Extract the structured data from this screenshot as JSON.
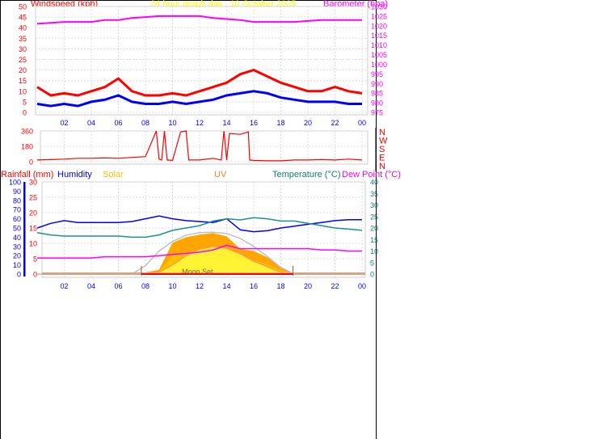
{
  "title": "24 hour graph day : 10 October 2025",
  "hour_labels": [
    "02",
    "04",
    "06",
    "08",
    "10",
    "12",
    "14",
    "16",
    "18",
    "20",
    "22",
    "00"
  ],
  "chart_data": [
    {
      "type": "line",
      "name": "wind-barometer",
      "left_label": "Windspeed (kph)",
      "right_label": "Barometer (hpa)",
      "ylim": [
        0,
        50
      ],
      "y_ticks": [
        "0",
        "5",
        "10",
        "15",
        "20",
        "25",
        "30",
        "35",
        "40",
        "45",
        "50"
      ],
      "y2lim": [
        975,
        1030
      ],
      "y2_ticks": [
        "975",
        "980",
        "985",
        "990",
        "995",
        "1000",
        "1005",
        "1010",
        "1015",
        "1020",
        "1025",
        "1030"
      ],
      "x_hours": [
        0,
        1,
        2,
        3,
        4,
        5,
        6,
        7,
        8,
        9,
        10,
        11,
        12,
        13,
        14,
        15,
        16,
        17,
        18,
        19,
        20,
        21,
        22,
        23,
        24
      ],
      "grid": true,
      "series": [
        {
          "key": "gust",
          "color": "#ff0000",
          "values": [
            12,
            8,
            9,
            8,
            10,
            12,
            16,
            10,
            8,
            8,
            9,
            8,
            10,
            12,
            14,
            18,
            20,
            17,
            14,
            12,
            10,
            10,
            12,
            10,
            9
          ]
        },
        {
          "key": "speed",
          "color": "#0000ff",
          "values": [
            4,
            3,
            4,
            3,
            5,
            6,
            8,
            5,
            4,
            4,
            5,
            4,
            5,
            6,
            8,
            9,
            10,
            9,
            7,
            6,
            5,
            5,
            5,
            4,
            4
          ]
        },
        {
          "key": "barometer",
          "color": "#ff00ff",
          "axis": "right",
          "values": [
            1021,
            1021.5,
            1022,
            1022,
            1022,
            1023,
            1023,
            1024,
            1024.5,
            1025,
            1025,
            1025,
            1025,
            1024,
            1023.5,
            1023,
            1022,
            1022,
            1022,
            1022,
            1022.5,
            1023,
            1023,
            1023,
            1023
          ]
        }
      ]
    },
    {
      "type": "line",
      "name": "wind-direction",
      "ylim": [
        0,
        360
      ],
      "y_ticks": [
        "0",
        "180",
        "360"
      ],
      "compass_labels": [
        "N",
        "W",
        "S",
        "E",
        "N"
      ],
      "x_hours": [
        0,
        1,
        2,
        3,
        4,
        5,
        6,
        7,
        8,
        8.8,
        9,
        9.2,
        9.4,
        9.6,
        10,
        10.6,
        11,
        11.2,
        12,
        13,
        13.6,
        13.8,
        14,
        14.2,
        15,
        15.6,
        15.7,
        16,
        17,
        18,
        19,
        20,
        21,
        22,
        23,
        24
      ],
      "series": [
        {
          "key": "direction",
          "color": "#ff0000",
          "values": [
            20,
            25,
            30,
            40,
            40,
            45,
            40,
            50,
            60,
            360,
            30,
            20,
            360,
            20,
            15,
            350,
            360,
            20,
            20,
            40,
            20,
            360,
            20,
            330,
            320,
            350,
            20,
            15,
            10,
            10,
            20,
            20,
            25,
            20,
            30,
            20
          ]
        }
      ]
    },
    {
      "type": "line",
      "name": "rain-humidity-solar-temp",
      "labels": {
        "rainfall": "Rainfall (mm)",
        "humidity": "Humidity",
        "solar": "Solar",
        "uv": "UV",
        "temperature": "Temperature (°C)",
        "dewpoint": "Dew Point (°C)"
      },
      "humidity_ticks": [
        "0",
        "10",
        "20",
        "30",
        "40",
        "50",
        "60",
        "70",
        "80",
        "90",
        "100"
      ],
      "rain_ticks": [
        "0",
        "5",
        "10",
        "15",
        "20",
        "25",
        "30"
      ],
      "temp_ticks": [
        "0",
        "5",
        "10",
        "15",
        "20",
        "25",
        "30",
        "35",
        "40"
      ],
      "humidity_lim": [
        0,
        100
      ],
      "rain_lim": [
        0,
        30
      ],
      "temp_lim": [
        0,
        40
      ],
      "annotation": "Moon Set",
      "sunrise_hour": 7.7,
      "sunset_hour": 18.9,
      "x_hours": [
        0,
        1,
        2,
        3,
        4,
        5,
        6,
        7,
        8,
        9,
        10,
        11,
        12,
        13,
        14,
        15,
        16,
        17,
        18,
        19,
        20,
        21,
        22,
        23,
        24
      ],
      "series": [
        {
          "key": "humidity",
          "color": "#0000ff",
          "values": [
            50,
            55,
            58,
            56,
            56,
            56,
            56,
            57,
            60,
            63,
            60,
            58,
            57,
            56,
            60,
            48,
            46,
            47,
            50,
            52,
            54,
            56,
            58,
            59,
            59
          ]
        },
        {
          "key": "temperature",
          "color": "#20908a",
          "values": [
            18,
            17,
            16.5,
            16.5,
            16.5,
            16.5,
            16.5,
            16,
            16,
            17,
            19,
            20,
            21,
            23,
            24,
            23.5,
            24.5,
            24,
            23,
            23,
            22,
            21,
            20,
            19.5,
            19
          ]
        },
        {
          "key": "dewpoint",
          "color": "#ff00ff",
          "values": [
            7,
            7,
            7,
            7,
            7,
            7.5,
            7.5,
            7.5,
            7.5,
            8,
            8.5,
            9,
            9.5,
            10.5,
            12.5,
            11,
            11,
            11,
            11,
            11,
            11,
            10.5,
            10.5,
            10,
            10
          ]
        },
        {
          "key": "rainfall",
          "color": "#ff0000",
          "values": [
            0,
            0,
            0,
            0,
            0,
            0,
            0,
            0,
            0,
            0,
            0,
            0,
            0,
            0,
            0,
            0,
            0,
            0,
            0,
            0,
            0,
            0,
            0,
            0,
            0
          ]
        },
        {
          "key": "solar",
          "color": "#ffa500",
          "values": [
            0,
            0,
            0,
            0,
            0,
            0,
            0,
            0,
            4,
            10,
            75,
            88,
            94,
            98,
            90,
            60,
            55,
            40,
            15,
            0,
            0,
            0,
            0,
            0,
            0
          ]
        },
        {
          "key": "solar_max",
          "color": "#c0c0c0",
          "values": [
            0,
            0,
            0,
            0,
            0,
            0,
            0,
            0,
            20,
            55,
            78,
            93,
            99,
            100,
            97,
            85,
            66,
            42,
            16,
            0,
            0,
            0,
            0,
            0,
            0
          ]
        },
        {
          "key": "uv",
          "color": "#ff8030",
          "values": [
            0,
            0,
            0,
            0,
            0,
            0,
            0,
            0,
            1,
            2,
            10,
            20,
            27,
            30,
            28,
            22,
            14,
            8,
            2,
            0,
            0,
            0,
            0,
            0,
            0
          ]
        }
      ]
    }
  ]
}
